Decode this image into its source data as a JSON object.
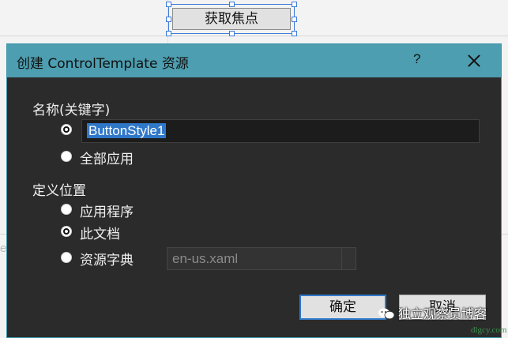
{
  "designer": {
    "focus_button_label": "获取焦点",
    "edge_char": "e"
  },
  "dialog": {
    "title": "创建 ControlTemplate 资源",
    "help_label": "?",
    "name_section": {
      "label": "名称(关键字)",
      "name_value": "ButtonStyle1",
      "apply_all_label": "全部应用"
    },
    "define_section": {
      "label": "定义位置",
      "options": [
        {
          "label": "应用程序",
          "checked": false
        },
        {
          "label": "此文档",
          "checked": true
        },
        {
          "label": "资源字典",
          "checked": false
        }
      ],
      "resource_dictionary_value": "en-us.xaml"
    },
    "ok_label": "确定",
    "cancel_label": "取消"
  },
  "watermark": {
    "text": "独立观察员博客",
    "domain": "dlgcy.com"
  },
  "colors": {
    "titlebar": "#4d9eb0",
    "dialog_bg": "#2b2b2b",
    "selection": "#2f78c9",
    "adorner": "#3d7ad8"
  }
}
